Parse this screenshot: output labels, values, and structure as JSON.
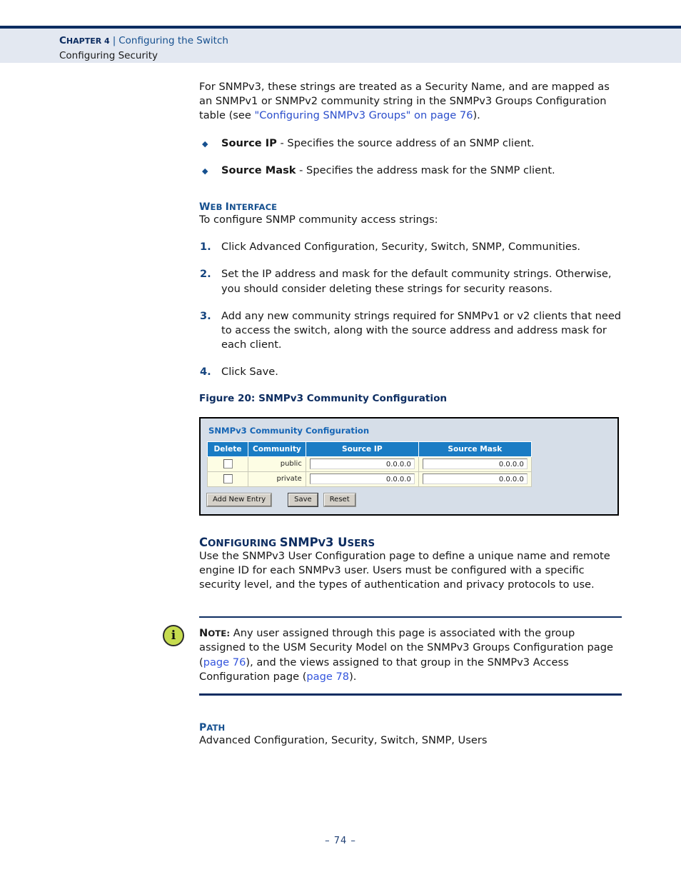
{
  "header": {
    "chapter_label": "Chapter 4",
    "chapter_label_lead": "C",
    "chapter_label_rest": "HAPTER 4",
    "separator": "|",
    "chapter_title": "Configuring the Switch",
    "section_title": "Configuring Security"
  },
  "intro": {
    "text_before_link": "For SNMPv3, these strings are treated as a Security Name, and are mapped as an SNMPv1 or SNMPv2 community string in the SNMPv3 Groups Configuration table (see ",
    "link_text": "\"Configuring SNMPv3 Groups\" on page 76",
    "text_after_link": ")."
  },
  "bullets": [
    {
      "icon": "diamond-bullet-icon",
      "term": "Source IP",
      "description": " - Specifies the source address of an SNMP client."
    },
    {
      "icon": "diamond-bullet-icon",
      "term": "Source Mask",
      "description": " - Specifies the address mask for the SNMP client."
    }
  ],
  "web_interface": {
    "heading_cap": "W",
    "heading_rest": "EB ",
    "heading_cap2": "I",
    "heading_rest2": "NTERFACE",
    "heading_full": "WEB INTERFACE",
    "lead_in": "To configure SNMP community access strings:",
    "steps": [
      {
        "number": "1.",
        "text": "Click Advanced Configuration, Security, Switch, SNMP, Communities."
      },
      {
        "number": "2.",
        "text": "Set the IP address and mask for the default community strings. Otherwise, you should consider deleting these strings for security reasons."
      },
      {
        "number": "3.",
        "text": "Add any new community strings required for SNMPv1 or v2 clients that need to access the switch, along with the source address and address mask for each client."
      },
      {
        "number": "4.",
        "text": "Click Save."
      }
    ]
  },
  "figure": {
    "caption": "Figure 20:  SNMPv3 Community Configuration",
    "app": {
      "title": "SNMPv3 Community Configuration",
      "columns": [
        "Delete",
        "Community",
        "Source IP",
        "Source Mask"
      ],
      "rows": [
        {
          "delete_checked": false,
          "community": "public",
          "source_ip": "0.0.0.0",
          "source_mask": "0.0.0.0"
        },
        {
          "delete_checked": false,
          "community": "private",
          "source_ip": "0.0.0.0",
          "source_mask": "0.0.0.0"
        }
      ],
      "buttons": [
        {
          "label": "Add New Entry",
          "focused": false
        },
        {
          "label": "Save",
          "focused": true
        },
        {
          "label": "Reset",
          "focused": false
        }
      ]
    }
  },
  "users_section": {
    "heading_c1": "C",
    "heading_r1": "ONFIGURING ",
    "heading_c2": "SNMP",
    "heading_r2": "V",
    "heading_c3": "3 U",
    "heading_r3": "SERS",
    "heading_full": "CONFIGURING SNMPv3 USERS",
    "body": "Use the SNMPv3 User Configuration page to define a unique name and remote engine ID for each SNMPv3 user. Users must be configured with a specific security level, and the types of authentication and privacy protocols to use."
  },
  "note": {
    "icon": "info-icon",
    "icon_glyph": "i",
    "label_cap": "N",
    "label_rest": "OTE:",
    "label_full": "NOTE:",
    "text_1": " Any user assigned through this page is associated with the group assigned to the USM Security Model on the SNMPv3 Groups Configuration page (",
    "link_1": "page 76",
    "text_2": "), and the views assigned to that group in the SNMPv3 Access Configuration page (",
    "link_2": "page 78",
    "text_3": ")."
  },
  "path_section": {
    "heading_cap": "P",
    "heading_rest": "ATH",
    "heading_full": "PATH",
    "value": "Advanced Configuration, Security, Switch, SNMP, Users"
  },
  "footer": {
    "page_number": "–  74  –"
  },
  "colors": {
    "header_band": "#e3e8f1",
    "navy": "#0d2d61",
    "heading_blue": "#16508f",
    "link_blue": "#2b4ecb",
    "figure_bg": "#d6dee8",
    "table_header_blue": "#1a7cc4",
    "table_row_bg": "#fdfde4",
    "note_icon_green": "#c6dc4f"
  }
}
